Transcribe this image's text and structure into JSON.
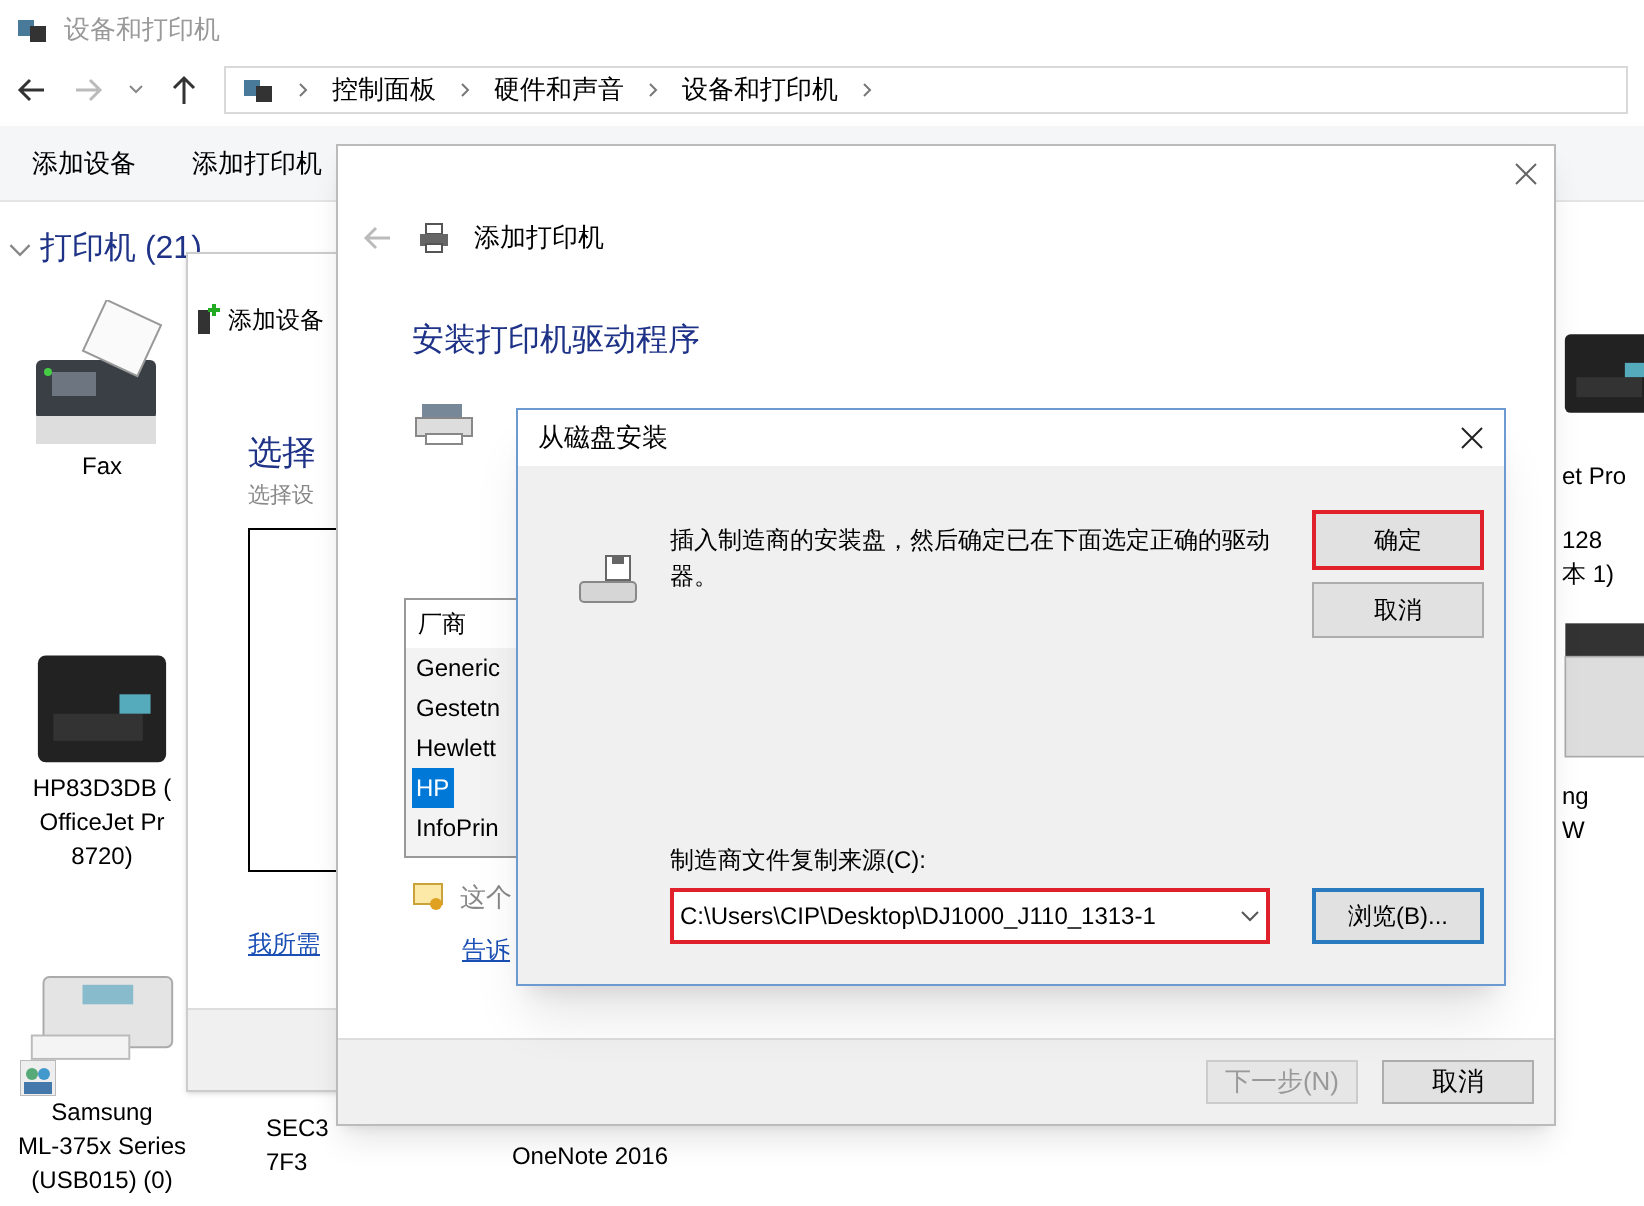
{
  "explorer": {
    "title": "设备和打印机",
    "breadcrumb": [
      "控制面板",
      "硬件和声音",
      "设备和打印机"
    ],
    "toolbar": [
      "添加设备",
      "添加打印机"
    ],
    "section": {
      "label": "打印机 (21)",
      "expanded": true
    },
    "devices": [
      {
        "kind": "fax",
        "lines": [
          "Fax"
        ]
      },
      {
        "kind": "inkjet",
        "lines": [
          "HP83D3DB (",
          "OfficeJet Pr",
          "8720)"
        ]
      },
      {
        "kind": "shared",
        "lines": [
          "Samsung",
          "ML-375x Series",
          "(USB015) (0)"
        ]
      },
      {
        "kind": "none",
        "lines": [
          "SEC3",
          "7F3"
        ]
      },
      {
        "kind": "none",
        "lines": [
          "OneNote 2016"
        ]
      },
      {
        "kind": "inkjet",
        "lines": [
          "et Pro"
        ]
      },
      {
        "kind": "none",
        "lines": [
          "128",
          "本 1)"
        ]
      },
      {
        "kind": "laser",
        "lines": [
          "ng",
          "W"
        ]
      }
    ]
  },
  "add_device": {
    "title": "添加设备",
    "heading": "选择",
    "subtitle": "选择设",
    "link": "我所需"
  },
  "add_printer": {
    "title": "添加打印机",
    "heading": "安装打印机驱动程序",
    "list": {
      "header": "厂商",
      "items": [
        {
          "label": "Generic",
          "selected": false
        },
        {
          "label": "Gestetn",
          "selected": false
        },
        {
          "label": "Hewlett",
          "selected": false
        },
        {
          "label": "HP",
          "selected": true
        },
        {
          "label": "InfoPrin",
          "selected": false
        }
      ]
    },
    "note": "这个",
    "link": "告诉",
    "buttons": [
      {
        "label": "下一步(N)",
        "disabled": true
      },
      {
        "label": "取消",
        "disabled": false
      }
    ]
  },
  "disk_dialog": {
    "title": "从磁盘安装",
    "message": "插入制造商的安装盘，然后确定已在下面选定正确的驱动器。",
    "ok": "确定",
    "cancel": "取消",
    "source_label": "制造商文件复制来源(C):",
    "source_value": "C:\\Users\\CIP\\Desktop\\DJ1000_J110_1313-1",
    "browse": "浏览(B)..."
  }
}
